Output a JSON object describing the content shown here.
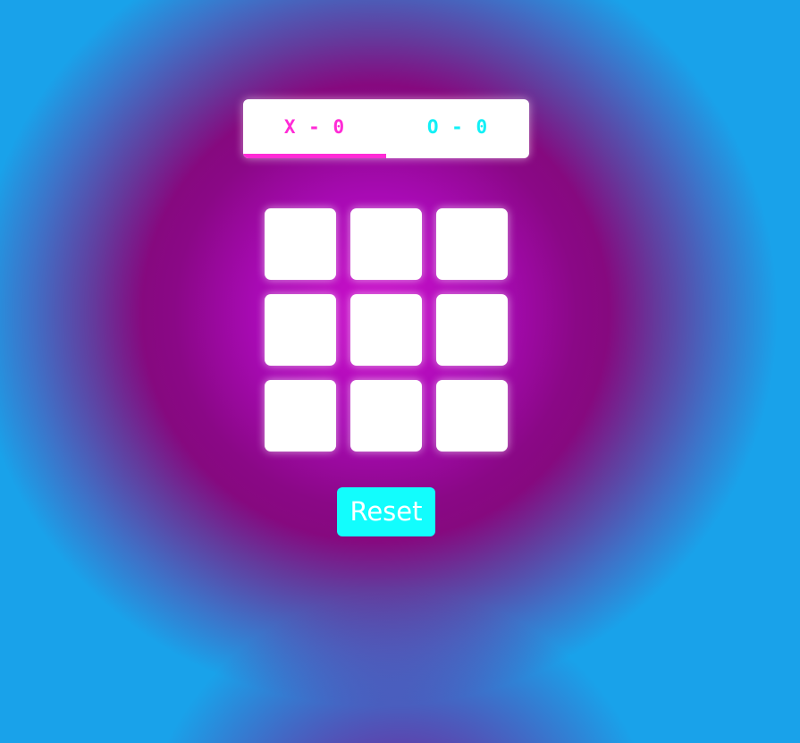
{
  "scoreboard": {
    "x_label": "X - 0",
    "o_label": "O - 0",
    "active_player": "X"
  },
  "board": {
    "cells": [
      "",
      "",
      "",
      "",
      "",
      "",
      "",
      "",
      ""
    ]
  },
  "controls": {
    "reset_label": "Reset"
  },
  "colors": {
    "x_color": "#ff2bd6",
    "o_color": "#12f0f6",
    "accent": "#ff2bd6",
    "reset_bg": "#12fdfd",
    "reset_text": "#ffffff"
  }
}
